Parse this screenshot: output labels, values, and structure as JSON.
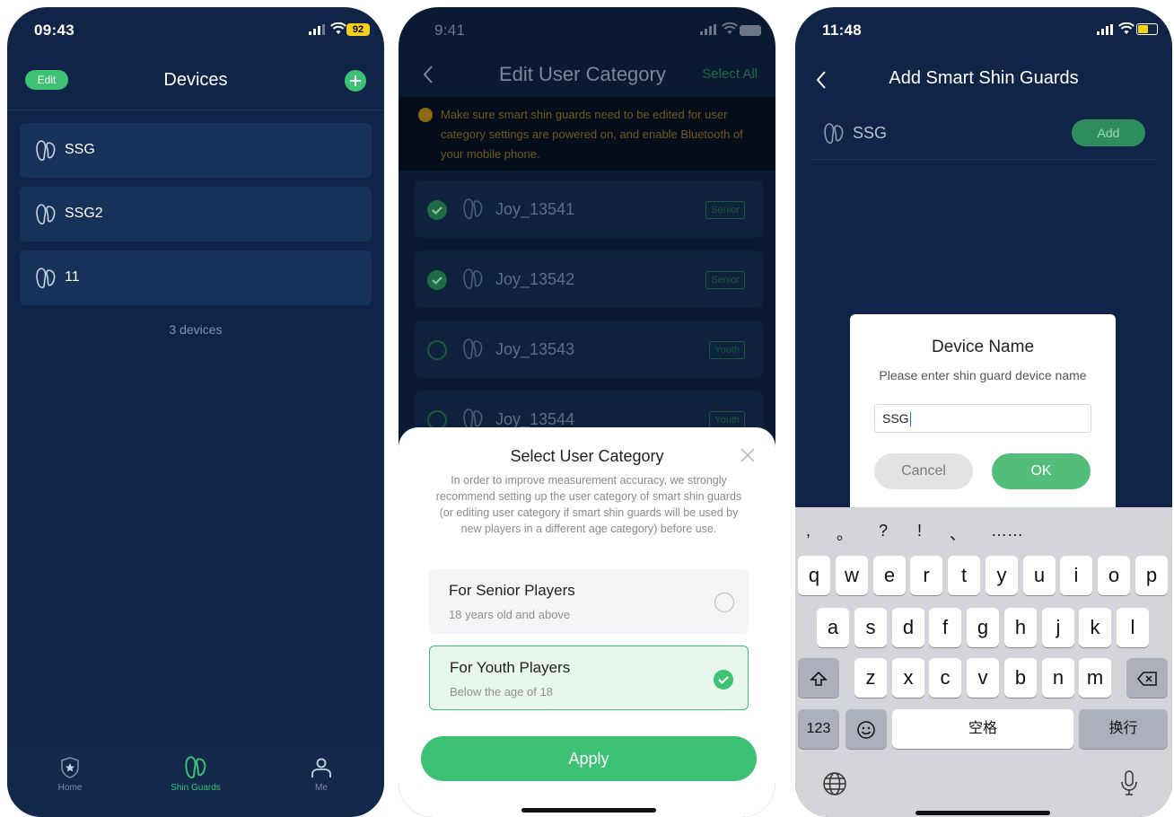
{
  "phone1": {
    "status": {
      "time": "09:43",
      "battery": "92"
    },
    "nav": {
      "edit_label": "Edit",
      "title": "Devices"
    },
    "devices": [
      {
        "name": "SSG"
      },
      {
        "name": "SSG2"
      },
      {
        "name": "11"
      }
    ],
    "device_count": "3 devices",
    "tabs": [
      {
        "label": "Home",
        "icon": "shield-star-icon",
        "active": false
      },
      {
        "label": "Shin Guards",
        "icon": "shin-guard-icon",
        "active": true
      },
      {
        "label": "Me",
        "icon": "person-icon",
        "active": false
      }
    ]
  },
  "phone2": {
    "status": {
      "time": "9:41"
    },
    "nav": {
      "title": "Edit User Category",
      "select_all": "Select All"
    },
    "notice": "Make sure smart shin guards need to be edited for user category settings are powered on, and enable Bluetooth of your mobile phone.",
    "users": [
      {
        "name": "Joy_13541",
        "tag": "Senior",
        "checked": true
      },
      {
        "name": "Joy_13542",
        "tag": "Senior",
        "checked": true
      },
      {
        "name": "Joy_13543",
        "tag": "Youth",
        "checked": false
      },
      {
        "name": "Joy_13544",
        "tag": "Youth",
        "checked": false
      }
    ],
    "sheet": {
      "title": "Select User Category",
      "description": "In order to improve measurement accuracy, we strongly recommend setting up the user category of smart shin guards (or editing user category if smart shin guards will be used by new players in a different age category) before use.",
      "options": [
        {
          "title": "For Senior Players",
          "subtitle": "18 years old and above",
          "selected": false
        },
        {
          "title": "For Youth Players",
          "subtitle": "Below the age of 18",
          "selected": true
        }
      ],
      "apply_label": "Apply"
    }
  },
  "phone3": {
    "status": {
      "time": "11:48"
    },
    "nav": {
      "title": "Add Smart Shin Guards"
    },
    "found_device": {
      "name": "SSG",
      "add_label": "Add"
    },
    "dialog": {
      "title": "Device Name",
      "subtitle": "Please enter shin guard device name",
      "input_value": "SSG",
      "cancel_label": "Cancel",
      "ok_label": "OK"
    },
    "keyboard": {
      "candidates": [
        ",",
        "。",
        "?",
        "!",
        "、",
        "……"
      ],
      "row1": [
        "q",
        "w",
        "e",
        "r",
        "t",
        "y",
        "u",
        "i",
        "o",
        "p"
      ],
      "row2": [
        "a",
        "s",
        "d",
        "f",
        "g",
        "h",
        "j",
        "k",
        "l"
      ],
      "row3": [
        "z",
        "x",
        "c",
        "v",
        "b",
        "n",
        "m"
      ],
      "numbers_label": "123",
      "space_label": "空格",
      "return_label": "换行"
    }
  },
  "colors": {
    "accent": "#3cc175",
    "navy": "#0f2447",
    "card": "#173259",
    "battery_yellow": "#f5d018"
  }
}
